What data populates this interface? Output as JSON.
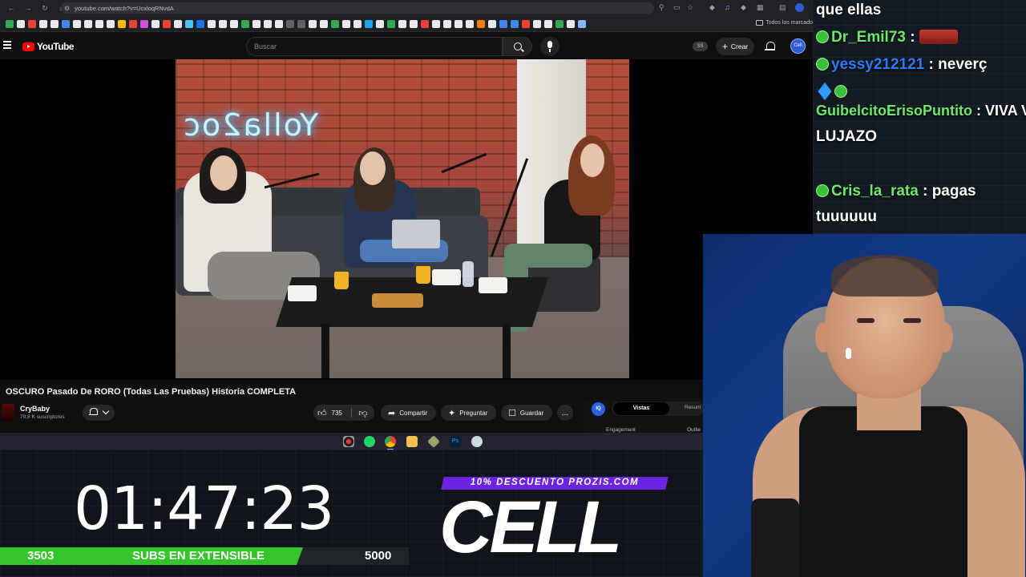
{
  "browser": {
    "url": "youtube.com/watch?v=UcxloqRNvdA",
    "bookmarks_folder": "Todos los marcado",
    "bookmark_colors": [
      "#34a853",
      "#e8eaed",
      "#ea4335",
      "#e8eaed",
      "#e8eaed",
      "#4285f4",
      "#e8eaed",
      "#e8eaed",
      "#e8eaed",
      "#e8eaed",
      "#fbbc04",
      "#ea4335",
      "#d04fd9",
      "#e8eaed",
      "#ea4335",
      "#e8eaed",
      "#4fc3f7",
      "#1a73e8",
      "#e8eaed",
      "#e8eaed",
      "#e8eaed",
      "#34a853",
      "#e8eaed",
      "#e8eaed",
      "#e8eaed",
      "#5f6368",
      "#5f6368",
      "#e8eaed",
      "#e8eaed",
      "#34a853",
      "#e8eaed",
      "#e8eaed",
      "#1da1f2",
      "#e8eaed",
      "#34a853",
      "#e8eaed",
      "#e8eaed",
      "#ea4335",
      "#e8eaed",
      "#e8eaed",
      "#e8eaed",
      "#e8eaed",
      "#f57c00",
      "#e8eaed",
      "#4285f4",
      "#4285f4",
      "#ea4335",
      "#e8eaed",
      "#e8eaed",
      "#34a853",
      "#e8eaed",
      "#8ab4f8"
    ]
  },
  "youtube": {
    "logo_text": "YouTube",
    "search_placeholder": "Buscar",
    "ss_label": "SS",
    "create_label": "Crear",
    "avatar_text": "Cell"
  },
  "video": {
    "neon_sign": "Yolla2oc",
    "title": "OSCURO Pasado De RORO (Todas Las Pruebas) Historia COMPLETA",
    "channel_name": "CryBaby",
    "subscribers": "79,8 K suscriptores",
    "likes": "735",
    "share_label": "Compartir",
    "ask_label": "Preguntar",
    "save_label": "Guardar",
    "more_label": "..."
  },
  "extension": {
    "logo": "IQ",
    "tab_active": "Vistas",
    "tab_inactive": "Resum",
    "sub_left": "Engagement",
    "sub_right": "Outlie"
  },
  "overlay": {
    "timer": "01:47:23",
    "subs_current": "3503",
    "subs_label": "SUBS EN EXTENSIBLE",
    "subs_goal": "5000",
    "subs_progress": 0.7006,
    "promo": "10% DESCUENTO PROZIS.COM",
    "brand": "CELL"
  },
  "chat": [
    {
      "id": "c0",
      "user": "",
      "message": "que ellas"
    },
    {
      "id": "c1",
      "user": "Dr_Emil73",
      "message": "",
      "badge": "Cell",
      "name_color": "#6fe86b",
      "emote": true
    },
    {
      "id": "c2",
      "user": "yessy212121",
      "message": "neverç",
      "badge": "Cell",
      "name_color": "#2f7cff"
    },
    {
      "id": "c3",
      "user": "GuibelcitoErisoPuntito",
      "message": "VIVA VOX Y SE DA EL",
      "name_color": "#6fe86b"
    },
    {
      "id": "c4",
      "user": "",
      "message": "LUJAZO"
    },
    {
      "id": "c5",
      "user": "Cris_la_rata",
      "message": "pagas",
      "badge": "Cell",
      "name_color": "#6fe86b"
    },
    {
      "id": "c6",
      "user": "",
      "message": "tuuuuuu"
    }
  ]
}
